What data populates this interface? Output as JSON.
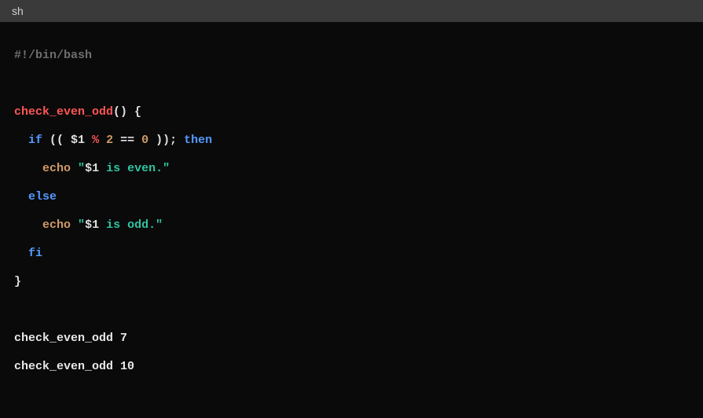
{
  "header": {
    "language_label": "sh"
  },
  "code": {
    "shebang": "#!/bin/bash",
    "func_name": "check_even_odd",
    "parens": "()",
    "open_brace": " {",
    "if_kw": "if",
    "dbl_paren_open": " (( ",
    "arg_var": "$1",
    "mod_op": " % ",
    "two": "2",
    "eq_op": " == ",
    "zero": "0",
    "dbl_paren_close": " ));",
    "then_kw": " then",
    "echo_kw": "echo",
    "quote": "\"",
    "str_var": "$1",
    "str_even": " is even.",
    "else_kw": "else",
    "str_odd": " is odd.",
    "fi_kw": "fi",
    "close_brace": "}",
    "call1_name": "check_even_odd ",
    "call1_arg": "7",
    "call2_name": "check_even_odd ",
    "call2_arg": "10"
  }
}
